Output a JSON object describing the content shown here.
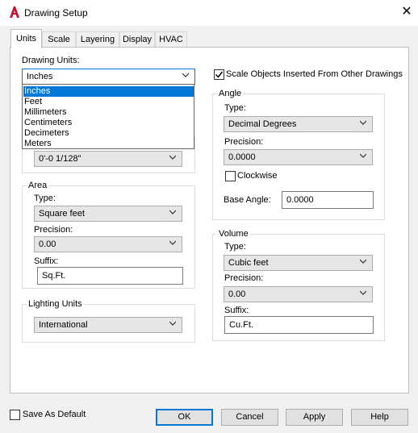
{
  "window": {
    "title": "Drawing Setup",
    "app_icon": "autocad-a-icon",
    "accent": "#c8102e"
  },
  "tabs": [
    {
      "label": "Units",
      "active": true
    },
    {
      "label": "Scale"
    },
    {
      "label": "Layering"
    },
    {
      "label": "Display"
    },
    {
      "label": "HVAC"
    }
  ],
  "drawing_units": {
    "label": "Drawing Units:",
    "value": "Inches",
    "options": [
      "Inches",
      "Feet",
      "Millimeters",
      "Centimeters",
      "Decimeters",
      "Meters"
    ]
  },
  "scale_objects": {
    "label": "Scale Objects Inserted From Other Drawings",
    "checked": true
  },
  "length": {
    "precision_value": "0'-0 1/128\""
  },
  "angle": {
    "title": "Angle",
    "type_label": "Type:",
    "type_value": "Decimal Degrees",
    "precision_label": "Precision:",
    "precision_value": "0.0000",
    "clockwise_label": "Clockwise",
    "clockwise_checked": false,
    "base_angle_label": "Base Angle:",
    "base_angle_value": "0.0000"
  },
  "area": {
    "title": "Area",
    "type_label": "Type:",
    "type_value": "Square feet",
    "precision_label": "Precision:",
    "precision_value": "0.00",
    "suffix_label": "Suffix:",
    "suffix_value": "Sq.Ft."
  },
  "volume": {
    "title": "Volume",
    "type_label": "Type:",
    "type_value": "Cubic feet",
    "precision_label": "Precision:",
    "precision_value": "0.00",
    "suffix_label": "Suffix:",
    "suffix_value": "Cu.Ft."
  },
  "lighting": {
    "title": "Lighting Units",
    "value": "International"
  },
  "footer": {
    "save_default_label": "Save As Default",
    "save_default_checked": false,
    "ok": "OK",
    "cancel": "Cancel",
    "apply": "Apply",
    "help": "Help"
  }
}
